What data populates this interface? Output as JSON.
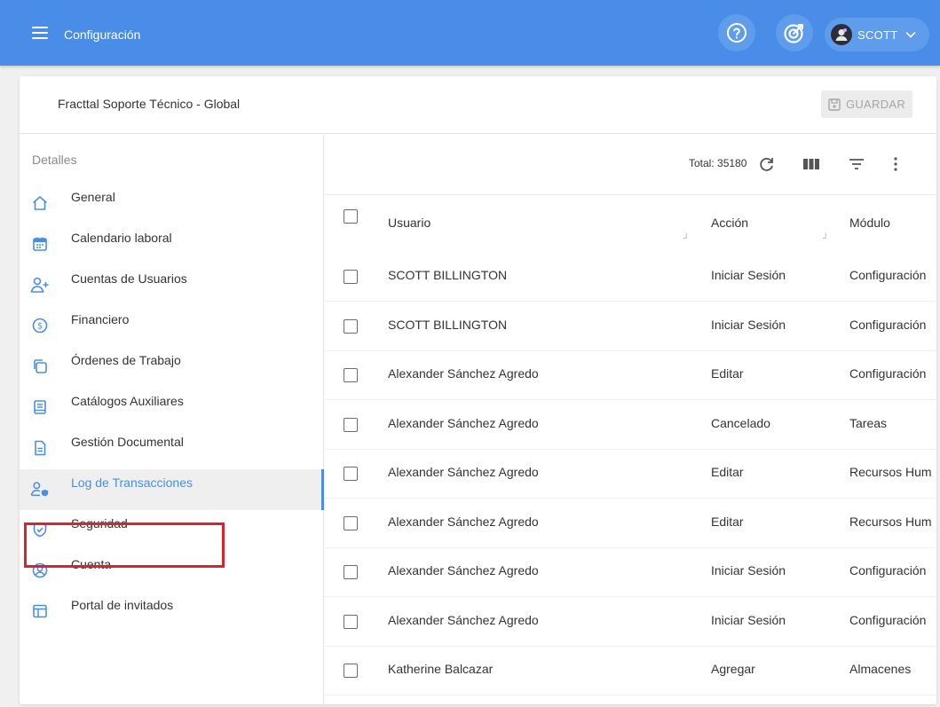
{
  "header": {
    "title": "Configuración",
    "user_name": "SCOTT"
  },
  "card": {
    "company_name": "Fracttal Soporte Técnico - Global",
    "save_label": "GUARDAR"
  },
  "sidebar": {
    "heading": "Detalles",
    "items": [
      {
        "label": "General",
        "icon": "home-icon"
      },
      {
        "label": "Calendario laboral",
        "icon": "calendar-icon"
      },
      {
        "label": "Cuentas de Usuarios",
        "icon": "user-add-icon"
      },
      {
        "label": "Financiero",
        "icon": "dollar-circle-icon"
      },
      {
        "label": "Órdenes de Trabajo",
        "icon": "copy-icon"
      },
      {
        "label": "Catálogos Auxiliares",
        "icon": "catalog-icon"
      },
      {
        "label": "Gestión Documental",
        "icon": "document-icon"
      },
      {
        "label": "Log de Transacciones",
        "icon": "user-shield-icon",
        "active": true
      },
      {
        "label": "Seguridad",
        "icon": "shield-check-icon"
      },
      {
        "label": "Cuenta",
        "icon": "account-circle-icon"
      },
      {
        "label": "Portal de invitados",
        "icon": "layout-icon"
      }
    ]
  },
  "toolbar": {
    "total_label": "Total: 35180"
  },
  "table": {
    "columns": [
      "Usuario",
      "Acción",
      "Módulo"
    ],
    "rows": [
      {
        "user": "SCOTT BILLINGTON",
        "action": "Iniciar Sesión",
        "module": "Configuración"
      },
      {
        "user": "SCOTT BILLINGTON",
        "action": "Iniciar Sesión",
        "module": "Configuración"
      },
      {
        "user": "Alexander Sánchez Agredo",
        "action": "Editar",
        "module": "Configuración"
      },
      {
        "user": "Alexander Sánchez Agredo",
        "action": "Cancelado",
        "module": "Tareas"
      },
      {
        "user": "Alexander Sánchez Agredo",
        "action": "Editar",
        "module": "Recursos Hum"
      },
      {
        "user": "Alexander Sánchez Agredo",
        "action": "Editar",
        "module": "Recursos Hum"
      },
      {
        "user": "Alexander Sánchez Agredo",
        "action": "Iniciar Sesión",
        "module": "Configuración"
      },
      {
        "user": "Alexander Sánchez Agredo",
        "action": "Iniciar Sesión",
        "module": "Configuración"
      },
      {
        "user": "Katherine Balcazar",
        "action": "Agregar",
        "module": "Almacenes"
      }
    ]
  },
  "colors": {
    "primary": "#4a8de8",
    "highlight": "#d9232d"
  }
}
